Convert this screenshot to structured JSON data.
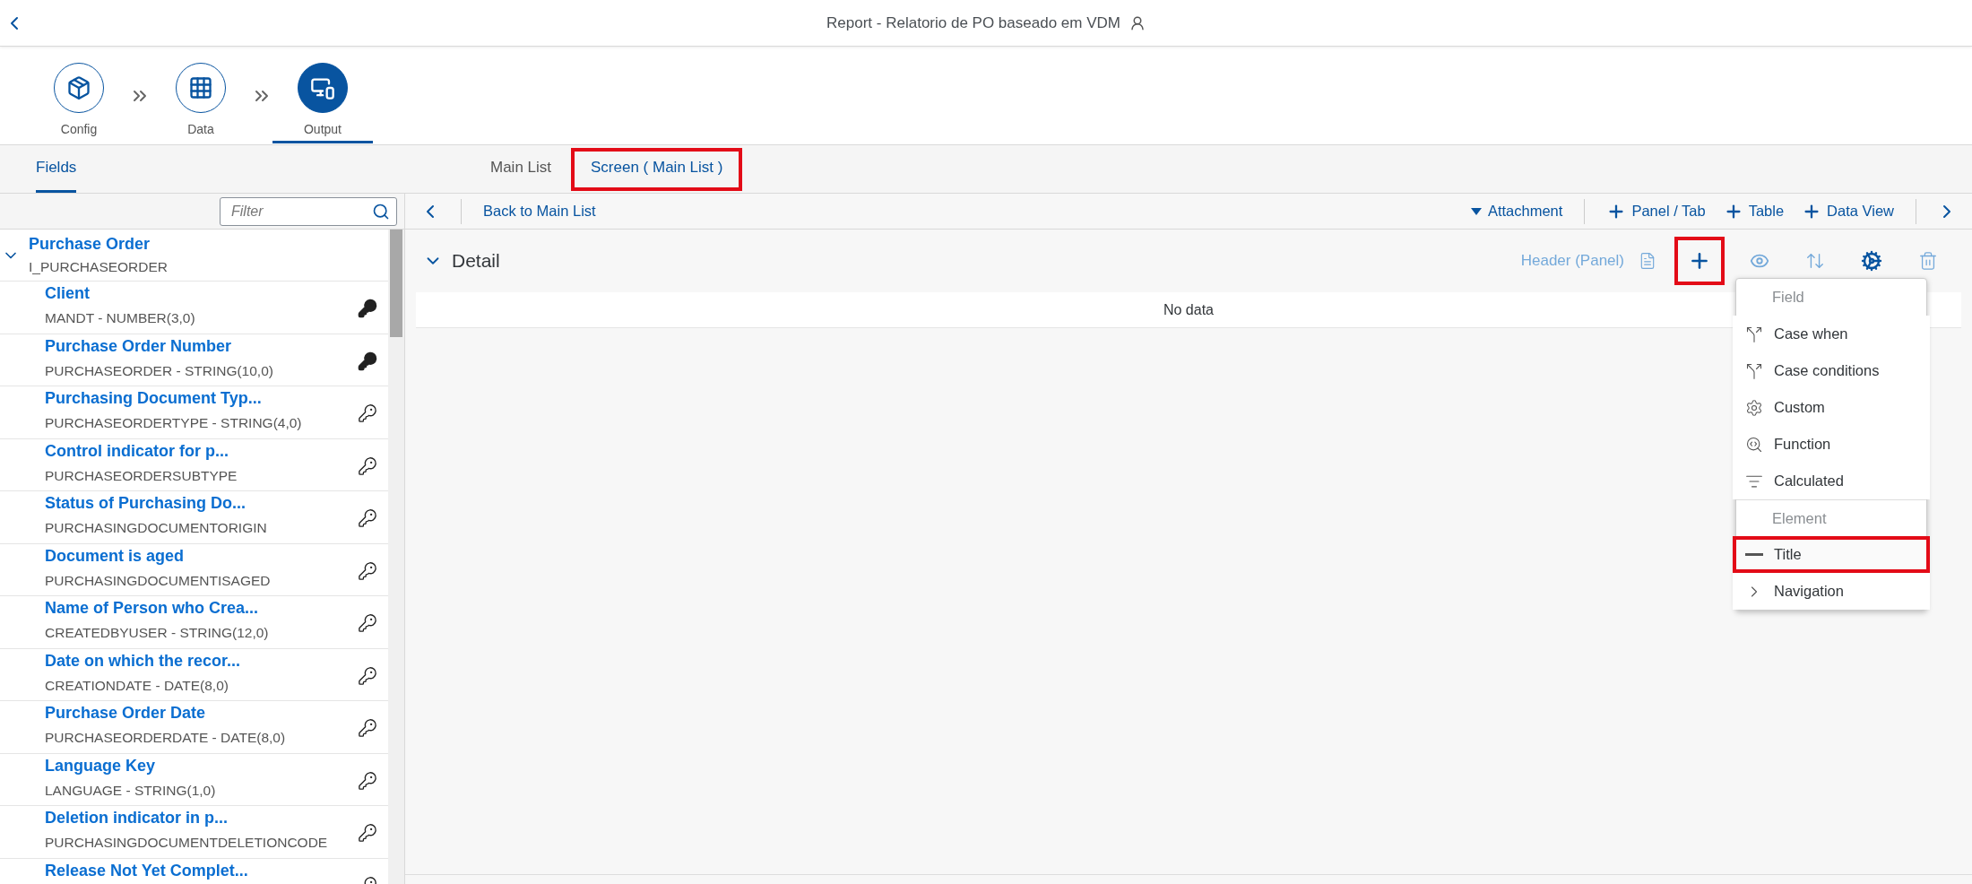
{
  "header": {
    "title": "Report - Relatorio de PO baseado em VDM"
  },
  "steps": [
    {
      "label": "Config",
      "selected": false
    },
    {
      "label": "Data",
      "selected": false
    },
    {
      "label": "Output",
      "selected": true
    }
  ],
  "left_tabs": [
    {
      "label": "Fields",
      "selected": true
    }
  ],
  "main_tabs": [
    {
      "label": "Main List",
      "selected": false,
      "highlighted": false
    },
    {
      "label": "Screen ( Main List )",
      "selected": true,
      "highlighted": true
    }
  ],
  "filter": {
    "placeholder": "Filter"
  },
  "tree": {
    "name": "Purchase Order",
    "sub": "I_PURCHASEORDER",
    "expanded": true,
    "children": [
      {
        "name": "Client",
        "sub": "MANDT - NUMBER(3,0)",
        "primary_key": true
      },
      {
        "name": "Purchase Order Number",
        "sub": "PURCHASEORDER - STRING(10,0)",
        "primary_key": true
      },
      {
        "name": "Purchasing Document Typ...",
        "sub": "PURCHASEORDERTYPE - STRING(4,0)",
        "primary_key": false
      },
      {
        "name": "Control indicator for p...",
        "sub": "PURCHASEORDERSUBTYPE",
        "primary_key": false
      },
      {
        "name": "Status of Purchasing Do...",
        "sub": "PURCHASINGDOCUMENTORIGIN",
        "primary_key": false
      },
      {
        "name": "Document is aged",
        "sub": "PURCHASINGDOCUMENTISAGED",
        "primary_key": false
      },
      {
        "name": "Name of Person who Crea...",
        "sub": "CREATEDBYUSER - STRING(12,0)",
        "primary_key": false
      },
      {
        "name": "Date on which the recor...",
        "sub": "CREATIONDATE - DATE(8,0)",
        "primary_key": false
      },
      {
        "name": "Purchase Order Date",
        "sub": "PURCHASEORDERDATE - DATE(8,0)",
        "primary_key": false
      },
      {
        "name": "Language Key",
        "sub": "LANGUAGE - STRING(1,0)",
        "primary_key": false
      },
      {
        "name": "Deletion indicator in p...",
        "sub": "PURCHASINGDOCUMENTDELETIONCODE",
        "primary_key": false
      },
      {
        "name": "Release Not Yet Complet...",
        "primary_key": false
      }
    ]
  },
  "toolbar": {
    "back": "Back to Main List",
    "actions": [
      {
        "kind": "dropdown",
        "label": "Attachment"
      },
      {
        "kind": "add",
        "label": "Panel / Tab"
      },
      {
        "kind": "add",
        "label": "Table"
      },
      {
        "kind": "add",
        "label": "Data View"
      }
    ]
  },
  "detail": {
    "title": "Detail",
    "expanded": true,
    "header_label": "Header (Panel)",
    "add_highlighted": true,
    "empty_text": "No data"
  },
  "menu": [
    {
      "kind": "header",
      "label": "Field"
    },
    {
      "kind": "item",
      "label": "Case when",
      "highlighted": false
    },
    {
      "kind": "item",
      "label": "Case conditions",
      "highlighted": false
    },
    {
      "kind": "item",
      "label": "Custom",
      "highlighted": false
    },
    {
      "kind": "item",
      "label": "Function",
      "highlighted": false
    },
    {
      "kind": "item",
      "label": "Calculated",
      "highlighted": false
    },
    {
      "kind": "header",
      "label": "Element"
    },
    {
      "kind": "item",
      "label": "Title",
      "highlighted": true
    },
    {
      "kind": "item",
      "label": "Navigation",
      "highlighted": false
    }
  ]
}
